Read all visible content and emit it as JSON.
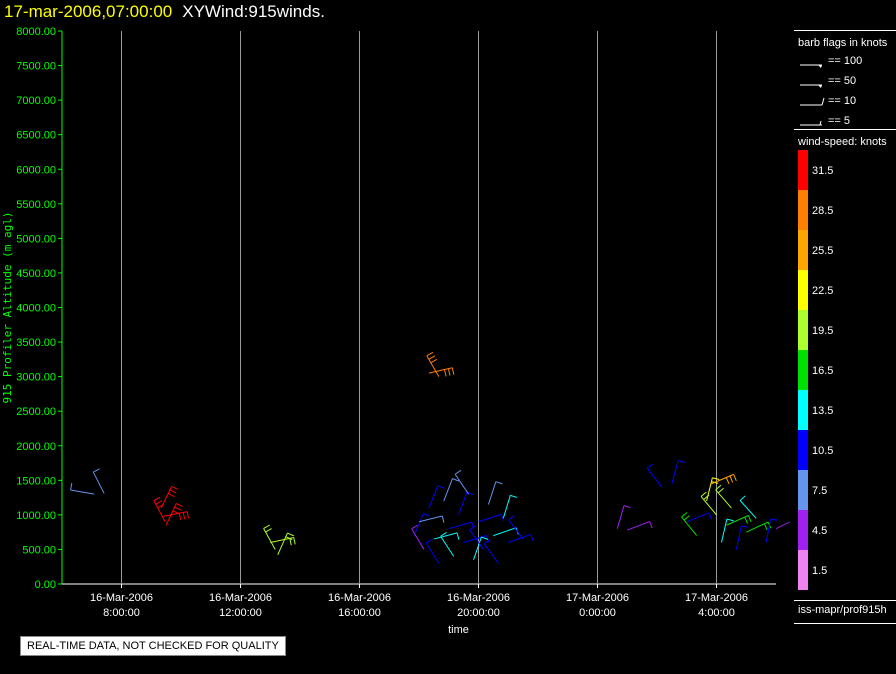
{
  "header": {
    "datetime": "17-mar-2006,07:00:00",
    "product": "XYWind:915winds."
  },
  "legend": {
    "barb_title": "barb flags in knots",
    "barb_flags": [
      {
        "label": "== 100",
        "kind": "pennant"
      },
      {
        "label": "== 50",
        "kind": "pennant"
      },
      {
        "label": "== 10",
        "kind": "full"
      },
      {
        "label": "== 5",
        "kind": "half"
      }
    ],
    "speed_title": "wind-speed: knots",
    "speed_bins": [
      {
        "label": "31.5",
        "color": "#ff0000"
      },
      {
        "label": "28.5",
        "color": "#ff7f00"
      },
      {
        "label": "25.5",
        "color": "#ffa500"
      },
      {
        "label": "22.5",
        "color": "#ffff00"
      },
      {
        "label": "19.5",
        "color": "#adff2f"
      },
      {
        "label": "16.5",
        "color": "#00e000"
      },
      {
        "label": "13.5",
        "color": "#00ffff"
      },
      {
        "label": "10.5",
        "color": "#0000ff"
      },
      {
        "label": "7.5",
        "color": "#6495ed"
      },
      {
        "label": "4.5",
        "color": "#a020f0"
      },
      {
        "label": "1.5",
        "color": "#ee82ee"
      }
    ]
  },
  "source": "iss-mapr/prof915h",
  "notice": "REAL-TIME DATA, NOT CHECKED FOR QUALITY",
  "chart_data": {
    "type": "scatter",
    "title": "17-mar-2006,07:00:00  XYWind:915winds.",
    "xlabel": "time",
    "ylabel": "915 Profiler Altitude (m agl)",
    "ylim": [
      0,
      8000
    ],
    "xlim_hours": [
      -6.5,
      23.5
    ],
    "yticks": [
      "0.00",
      "500.00",
      "1000.00",
      "1500.00",
      "2000.00",
      "2500.00",
      "3000.00",
      "3500.00",
      "4000.00",
      "4500.00",
      "5000.00",
      "5500.00",
      "6000.00",
      "6500.00",
      "7000.00",
      "7500.00",
      "8000.00"
    ],
    "xticks": [
      {
        "date": "16-Mar-2006",
        "time": "8:00:00"
      },
      {
        "date": "16-Mar-2006",
        "time": "12:00:00"
      },
      {
        "date": "16-Mar-2006",
        "time": "16:00:00"
      },
      {
        "date": "16-Mar-2006",
        "time": "20:00:00"
      },
      {
        "date": "17-Mar-2006",
        "time": "0:00:00"
      },
      {
        "date": "17-Mar-2006",
        "time": "4:00:00"
      }
    ],
    "grid": "vertical",
    "axis_color": "#00ff00",
    "series": [
      {
        "values": [
          {
            "x": "16-Mar-2006 07:05",
            "y": 1300,
            "speed": 7
          },
          {
            "x": "16-Mar-2006 07:25",
            "y": 1310,
            "speed": 7
          },
          {
            "x": "16-Mar-2006 09:20",
            "y": 1100,
            "speed": 31
          },
          {
            "x": "16-Mar-2006 09:25",
            "y": 980,
            "speed": 31
          },
          {
            "x": "16-Mar-2006 09:28",
            "y": 900,
            "speed": 31
          },
          {
            "x": "16-Mar-2006 09:30",
            "y": 850,
            "speed": 31
          },
          {
            "x": "16-Mar-2006 13:00",
            "y": 600,
            "speed": 19
          },
          {
            "x": "16-Mar-2006 13:10",
            "y": 500,
            "speed": 19
          },
          {
            "x": "16-Mar-2006 13:15",
            "y": 420,
            "speed": 19
          },
          {
            "x": "16-Mar-2006 18:20",
            "y": 3050,
            "speed": 28
          },
          {
            "x": "16-Mar-2006 18:40",
            "y": 3000,
            "speed": 28
          },
          {
            "x": "16-Mar-2006 17:50",
            "y": 700,
            "speed": 10
          },
          {
            "x": "16-Mar-2006 18:00",
            "y": 900,
            "speed": 7
          },
          {
            "x": "16-Mar-2006 18:10",
            "y": 500,
            "speed": 4
          },
          {
            "x": "16-Mar-2006 18:20",
            "y": 1100,
            "speed": 10
          },
          {
            "x": "16-Mar-2006 18:30",
            "y": 650,
            "speed": 13
          },
          {
            "x": "16-Mar-2006 18:40",
            "y": 300,
            "speed": 10
          },
          {
            "x": "16-Mar-2006 18:50",
            "y": 1200,
            "speed": 7
          },
          {
            "x": "16-Mar-2006 19:00",
            "y": 800,
            "speed": 10
          },
          {
            "x": "16-Mar-2006 19:10",
            "y": 400,
            "speed": 13
          },
          {
            "x": "16-Mar-2006 19:20",
            "y": 1000,
            "speed": 10
          },
          {
            "x": "16-Mar-2006 19:30",
            "y": 600,
            "speed": 10
          },
          {
            "x": "16-Mar-2006 19:40",
            "y": 1300,
            "speed": 7
          },
          {
            "x": "16-Mar-2006 19:50",
            "y": 350,
            "speed": 13
          },
          {
            "x": "16-Mar-2006 20:00",
            "y": 900,
            "speed": 10
          },
          {
            "x": "16-Mar-2006 20:10",
            "y": 500,
            "speed": 10
          },
          {
            "x": "16-Mar-2006 20:20",
            "y": 1150,
            "speed": 7
          },
          {
            "x": "16-Mar-2006 20:30",
            "y": 700,
            "speed": 13
          },
          {
            "x": "16-Mar-2006 20:40",
            "y": 300,
            "speed": 10
          },
          {
            "x": "16-Mar-2006 20:50",
            "y": 950,
            "speed": 13
          },
          {
            "x": "16-Mar-2006 21:00",
            "y": 600,
            "speed": 10
          },
          {
            "x": "16-Mar-2006 21:30",
            "y": 650,
            "speed": 10
          },
          {
            "x": "17-Mar-2006 00:40",
            "y": 800,
            "speed": 4
          },
          {
            "x": "17-Mar-2006 01:00",
            "y": 780,
            "speed": 4
          },
          {
            "x": "17-Mar-2006 02:10",
            "y": 1400,
            "speed": 10
          },
          {
            "x": "17-Mar-2006 02:30",
            "y": 1450,
            "speed": 10
          },
          {
            "x": "17-Mar-2006 03:00",
            "y": 900,
            "speed": 10
          },
          {
            "x": "17-Mar-2006 03:20",
            "y": 700,
            "speed": 16
          },
          {
            "x": "17-Mar-2006 03:40",
            "y": 1200,
            "speed": 22
          },
          {
            "x": "17-Mar-2006 03:50",
            "y": 1450,
            "speed": 25
          },
          {
            "x": "17-Mar-2006 04:00",
            "y": 1000,
            "speed": 19
          },
          {
            "x": "17-Mar-2006 04:10",
            "y": 600,
            "speed": 13
          },
          {
            "x": "17-Mar-2006 04:20",
            "y": 850,
            "speed": 16
          },
          {
            "x": "17-Mar-2006 04:30",
            "y": 1100,
            "speed": 19
          },
          {
            "x": "17-Mar-2006 04:40",
            "y": 500,
            "speed": 10
          },
          {
            "x": "17-Mar-2006 05:00",
            "y": 750,
            "speed": 16
          },
          {
            "x": "17-Mar-2006 05:20",
            "y": 950,
            "speed": 13
          },
          {
            "x": "17-Mar-2006 05:40",
            "y": 600,
            "speed": 10
          },
          {
            "x": "17-Mar-2006 06:00",
            "y": 800,
            "speed": 4
          },
          {
            "x": "17-Mar-2006 06:20",
            "y": 900,
            "speed": 4
          },
          {
            "x": "17-Mar-2006 06:40",
            "y": 700,
            "speed": 10
          },
          {
            "x": "17-Mar-2006 07:00",
            "y": 500,
            "speed": 4
          }
        ]
      }
    ]
  }
}
